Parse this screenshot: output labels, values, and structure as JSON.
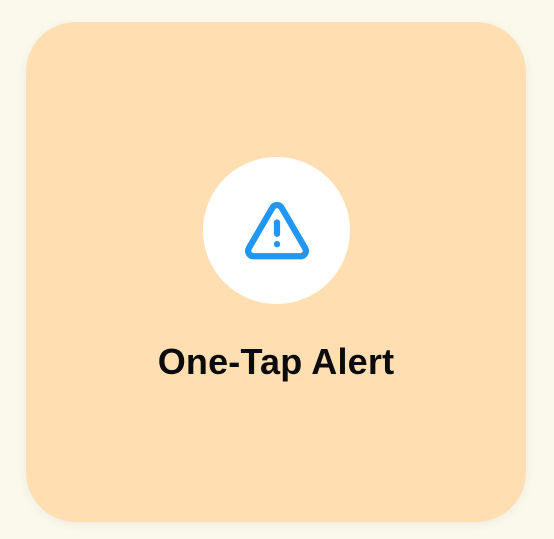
{
  "card": {
    "label": "One-Tap Alert",
    "icon": "warning-triangle-icon"
  },
  "colors": {
    "page_background": "#FBF8EC",
    "card_background": "#FFDFB2",
    "icon_background": "#FFFFFF",
    "icon_color": "#2196F3",
    "label_color": "#0B0B0B"
  }
}
